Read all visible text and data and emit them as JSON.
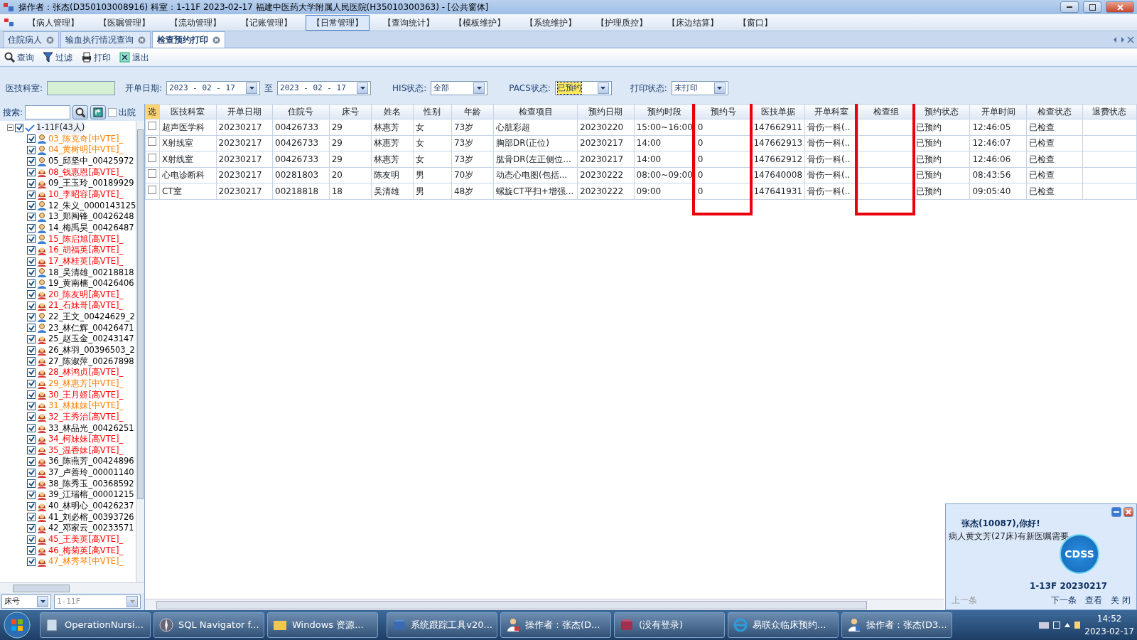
{
  "window": {
    "title": "操作者：张杰(D350103008916)  科室：1-11F  2023-02-17  福建中医药大学附属人民医院(H35010300363) - [公共窗体]"
  },
  "menu": [
    {
      "label": "【病人管理】",
      "selected": false
    },
    {
      "label": "【医嘱管理】",
      "selected": false
    },
    {
      "label": "【流动管理】",
      "selected": false
    },
    {
      "label": "【记账管理】",
      "selected": false
    },
    {
      "label": "【日常管理】",
      "selected": true
    },
    {
      "label": "【查询统计】",
      "selected": false
    },
    {
      "label": "【模板维护】",
      "selected": false
    },
    {
      "label": "【系统维护】",
      "selected": false
    },
    {
      "label": "【护理质控】",
      "selected": false
    },
    {
      "label": "【床边结算】",
      "selected": false
    },
    {
      "label": "【窗口】",
      "selected": false
    }
  ],
  "tabs": [
    {
      "label": "住院病人",
      "selected": false
    },
    {
      "label": "输血执行情况查询",
      "selected": false
    },
    {
      "label": "检查预约打印",
      "selected": true
    }
  ],
  "toolbar": [
    {
      "label": "查询",
      "kind": "search"
    },
    {
      "label": "过滤",
      "kind": "filter"
    },
    {
      "label": "打印",
      "kind": "print"
    },
    {
      "label": "退出",
      "kind": "exit"
    }
  ],
  "filters": {
    "dept_label": "医技科室:",
    "date_label": "开单日期:",
    "date_from": "2023 - 02 - 17",
    "date_sep": "至",
    "date_to": "2023 - 02 - 17",
    "his_label": "HIS状态:",
    "his_value": "全部",
    "pacs_label": "PACS状态:",
    "pacs_value": "已预约",
    "print_label": "打印状态:",
    "print_value": "未打印"
  },
  "sidebar": {
    "search_label": "搜索:",
    "discharged_label": "出院",
    "discharged_checked": false,
    "root": {
      "label": "1-11F(43人)",
      "checked": true,
      "expanded": true,
      "children": [
        {
          "label": "03_陈克奇[中VTE]_",
          "kind": "male",
          "checked": true,
          "color": "#ff8000"
        },
        {
          "label": "04_黄树明[中VTE]_",
          "kind": "male",
          "checked": true,
          "color": "#ff8000"
        },
        {
          "label": "05_邱坚中_00425972",
          "kind": "male",
          "checked": true,
          "color": "#000000"
        },
        {
          "label": "08_钱惠恩[高VTE]_",
          "kind": "female",
          "checked": true,
          "color": "#ff0000"
        },
        {
          "label": "09_王玉玲_00189929",
          "kind": "female",
          "checked": true,
          "color": "#000000"
        },
        {
          "label": "10_李昭容[高VTE]_",
          "kind": "female",
          "checked": true,
          "color": "#ff0000"
        },
        {
          "label": "12_朱义_0000143125",
          "kind": "male",
          "checked": true,
          "color": "#000000"
        },
        {
          "label": "13_郑闽锋_00426248",
          "kind": "male",
          "checked": true,
          "color": "#000000"
        },
        {
          "label": "14_梅禹昊_00426487",
          "kind": "male",
          "checked": true,
          "color": "#000000"
        },
        {
          "label": "15_陈启旭[高VTE]_",
          "kind": "male",
          "checked": true,
          "color": "#ff0000"
        },
        {
          "label": "16_胡福英[高VTE]_",
          "kind": "female",
          "checked": true,
          "color": "#ff0000"
        },
        {
          "label": "17_林桂英[高VTE]_",
          "kind": "female",
          "checked": true,
          "color": "#ff0000"
        },
        {
          "label": "18_吴清雄_00218818",
          "kind": "male",
          "checked": true,
          "color": "#000000"
        },
        {
          "label": "19_黄南楠_00426406",
          "kind": "male",
          "checked": true,
          "color": "#000000"
        },
        {
          "label": "20_陈友明[高VTE]_",
          "kind": "female",
          "checked": true,
          "color": "#ff0000"
        },
        {
          "label": "21_石妹哥[高VTE]_",
          "kind": "female",
          "checked": true,
          "color": "#ff0000"
        },
        {
          "label": "22_王文_00424629_2",
          "kind": "male",
          "checked": true,
          "color": "#000000"
        },
        {
          "label": "23_林仁辉_00426471",
          "kind": "male",
          "checked": true,
          "color": "#000000"
        },
        {
          "label": "25_赵玉金_00243147",
          "kind": "female",
          "checked": true,
          "color": "#000000"
        },
        {
          "label": "26_林羽_00396503_2",
          "kind": "female",
          "checked": true,
          "color": "#000000"
        },
        {
          "label": "27_陈溆萍_00267898",
          "kind": "female",
          "checked": true,
          "color": "#000000"
        },
        {
          "label": "28_林鸿贞[高VTE]_",
          "kind": "female",
          "checked": true,
          "color": "#ff0000"
        },
        {
          "label": "29_林惠芳[中VTE]_",
          "kind": "female",
          "checked": true,
          "color": "#ff8000"
        },
        {
          "label": "30_王月娇[高VTE]_",
          "kind": "female",
          "checked": true,
          "color": "#ff0000"
        },
        {
          "label": "31_林妹妹[中VTE]_",
          "kind": "female",
          "checked": true,
          "color": "#ff8000"
        },
        {
          "label": "32_王秀治[高VTE]_",
          "kind": "female",
          "checked": true,
          "color": "#ff0000"
        },
        {
          "label": "33_林品光_00426251",
          "kind": "female",
          "checked": true,
          "color": "#000000"
        },
        {
          "label": "34_柯妹妹[高VTE]_",
          "kind": "female",
          "checked": true,
          "color": "#ff0000"
        },
        {
          "label": "35_温香妹[高VTE]_",
          "kind": "female",
          "checked": true,
          "color": "#ff0000"
        },
        {
          "label": "36_陈燕芳_00424896",
          "kind": "female",
          "checked": true,
          "color": "#000000"
        },
        {
          "label": "37_卢善玲_00001140",
          "kind": "female",
          "checked": true,
          "color": "#000000"
        },
        {
          "label": "38_陈秀玉_00368592",
          "kind": "female",
          "checked": true,
          "color": "#000000"
        },
        {
          "label": "39_江瑞榕_00001215",
          "kind": "female",
          "checked": true,
          "color": "#000000"
        },
        {
          "label": "40_林明心_00426237",
          "kind": "female",
          "checked": true,
          "color": "#000000"
        },
        {
          "label": "41_刘必榕_00393726",
          "kind": "female",
          "checked": true,
          "color": "#000000"
        },
        {
          "label": "42_邓家云_00233571",
          "kind": "female",
          "checked": true,
          "color": "#000000"
        },
        {
          "label": "45_王美英[高VTE]_",
          "kind": "female",
          "checked": true,
          "color": "#ff0000"
        },
        {
          "label": "46_梅菊英[高VTE]_",
          "kind": "female",
          "checked": true,
          "color": "#ff0000"
        },
        {
          "label": "47_林秀琴[中VTE]_",
          "kind": "female",
          "checked": true,
          "color": "#ff8000"
        }
      ]
    },
    "sort_value": "床号",
    "ward_value": "1-11F"
  },
  "table": {
    "columns": [
      {
        "label": "选",
        "highlighted": false
      },
      {
        "label": "医技科室",
        "highlighted": false
      },
      {
        "label": "开单日期",
        "highlighted": false
      },
      {
        "label": "住院号",
        "highlighted": false
      },
      {
        "label": "床号",
        "highlighted": false
      },
      {
        "label": "姓名",
        "highlighted": false
      },
      {
        "label": "性别",
        "highlighted": false
      },
      {
        "label": "年龄",
        "highlighted": false
      },
      {
        "label": "检查项目",
        "highlighted": false
      },
      {
        "label": "预约日期",
        "highlighted": false
      },
      {
        "label": "预约时段",
        "highlighted": false
      },
      {
        "label": "预约号",
        "highlighted": true
      },
      {
        "label": "医技单据",
        "highlighted": false
      },
      {
        "label": "开单科室",
        "highlighted": false
      },
      {
        "label": "检查组",
        "highlighted": true
      },
      {
        "label": "预约状态",
        "highlighted": false
      },
      {
        "label": "开单时间",
        "highlighted": false
      },
      {
        "label": "检查状态",
        "highlighted": false
      },
      {
        "label": "退费状态",
        "highlighted": false
      }
    ],
    "rows": [
      {
        "checked": false,
        "cells": [
          null,
          "超声医学科",
          "20230217",
          "00426733",
          "29",
          "林惠芳",
          "女",
          "73岁",
          "心脏彩超",
          "20230220",
          "15:00~16:00",
          "0",
          "147662911",
          "骨伤一科(..",
          null,
          "已预约",
          "12:46:05",
          "已检查",
          null
        ]
      },
      {
        "checked": false,
        "cells": [
          null,
          "X射线室",
          "20230217",
          "00426733",
          "29",
          "林惠芳",
          "女",
          "73岁",
          "胸部DR(正位)",
          "20230217",
          "14:00",
          "0",
          "147662913",
          "骨伤一科(..",
          null,
          "已预约",
          "12:46:07",
          "已检查",
          null
        ]
      },
      {
        "checked": false,
        "cells": [
          null,
          "X射线室",
          "20230217",
          "00426733",
          "29",
          "林惠芳",
          "女",
          "73岁",
          "肱骨DR(左正侧位...",
          "20230217",
          "14:00",
          "0",
          "147662912",
          "骨伤一科(..",
          null,
          "已预约",
          "12:46:06",
          "已检查",
          null
        ]
      },
      {
        "checked": false,
        "cells": [
          null,
          "心电诊断科",
          "20230217",
          "00281803",
          "20",
          "陈友明",
          "男",
          "70岁",
          "动态心电图(包括...",
          "20230222",
          "08:00~09:00",
          "0",
          "147640008",
          "骨伤一科(..",
          null,
          "已预约",
          "08:43:56",
          "已检查",
          null
        ]
      },
      {
        "checked": false,
        "cells": [
          null,
          "CT室",
          "20230217",
          "00218818",
          "18",
          "吴清雄",
          "男",
          "48岁",
          "螺旋CT平扫+增强...",
          "20230222",
          "09:00",
          "0",
          "147641931",
          "骨伤一科(..",
          null,
          "已预约",
          "09:05:40",
          "已检查",
          null
        ]
      }
    ]
  },
  "popup": {
    "greeting": "张杰(10087),你好!",
    "message": "病人黄文芳(27床)有新医嘱需要",
    "logo": "CDSS",
    "footer": "1-13F 20230217",
    "prev": "上一条",
    "next": "下一条",
    "view": "查看",
    "close": "关 闭"
  },
  "taskbar": {
    "items": [
      "OperationNursi...",
      "SQL Navigator f...",
      "Windows 资源...",
      "系统跟踪工具v20...",
      "操作者：张杰(D...",
      "(没有登录)",
      "易联众临床预约...",
      "操作者：张杰(D3..."
    ],
    "time": "14:52",
    "date": "2023-02-17"
  }
}
